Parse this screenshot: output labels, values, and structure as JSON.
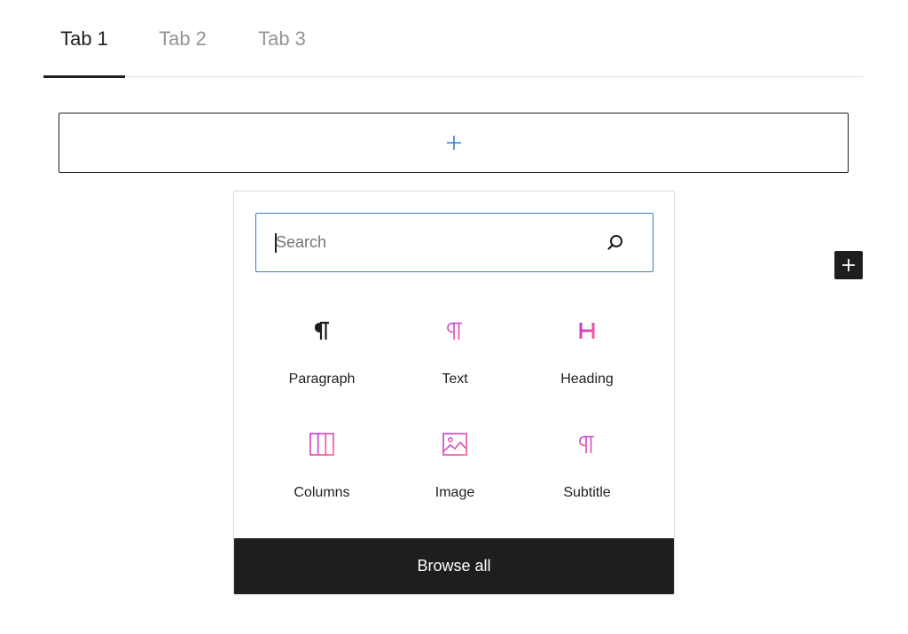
{
  "tabs": [
    {
      "label": "Tab 1",
      "active": true
    },
    {
      "label": "Tab 2",
      "active": false
    },
    {
      "label": "Tab 3",
      "active": false
    }
  ],
  "appender": {
    "icon": "plus-icon"
  },
  "side_add_button": {
    "icon": "plus-icon"
  },
  "inserter": {
    "search": {
      "placeholder": "Search",
      "value": "",
      "icon": "search-icon"
    },
    "blocks": [
      {
        "label": "Paragraph",
        "icon": "paragraph-icon"
      },
      {
        "label": "Text",
        "icon": "text-icon"
      },
      {
        "label": "Heading",
        "icon": "heading-icon"
      },
      {
        "label": "Columns",
        "icon": "columns-icon"
      },
      {
        "label": "Image",
        "icon": "image-icon"
      },
      {
        "label": "Subtitle",
        "icon": "subtitle-icon"
      }
    ],
    "browse_all_label": "Browse all"
  },
  "colors": {
    "dark": "#1e1e1e",
    "accent": "#3a7bd5",
    "gradient_start": "#c03dd6",
    "gradient_end": "#ff5c8a",
    "tab_inactive": "#949494"
  }
}
